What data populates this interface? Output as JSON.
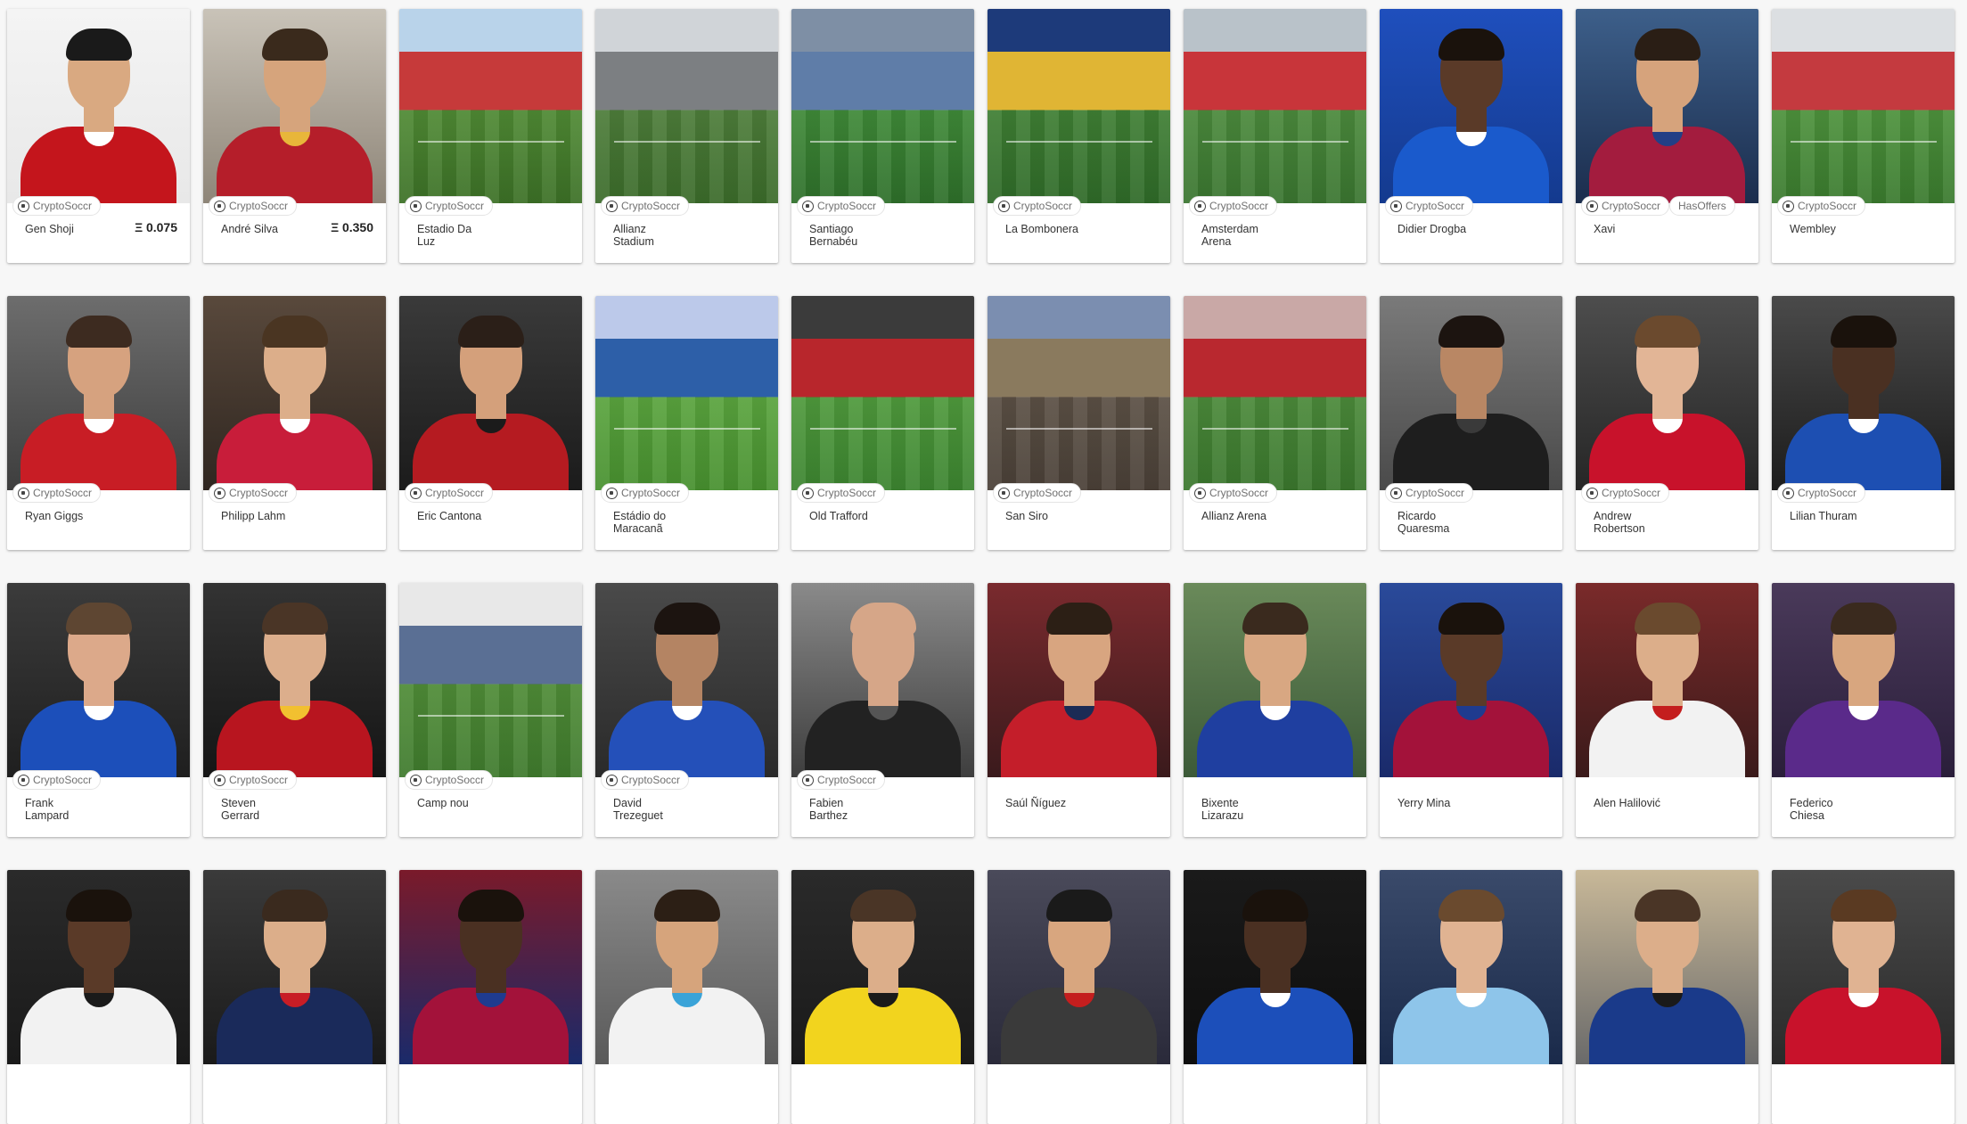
{
  "cards": [
    {
      "type": "player",
      "name": "Gen Shoji",
      "price": "Ξ 0.075",
      "badges": [
        "CryptoSoccr"
      ],
      "palette": {
        "b1": "#f4f4f4",
        "b2": "#e8e8e8",
        "j1": "#c4151c",
        "j2": "#ffffff",
        "skin": "#d9a981",
        "hair": "#1a1a1a"
      }
    },
    {
      "type": "player",
      "name": "André Silva",
      "price": "Ξ 0.350",
      "badges": [
        "CryptoSoccr"
      ],
      "palette": {
        "b1": "#c9c3b8",
        "b2": "#8e8578",
        "j1": "#b51e2a",
        "j2": "#e8b63a",
        "skin": "#d6a47c",
        "hair": "#3a2a1c"
      }
    },
    {
      "type": "stadium",
      "name": "Estadio Da\nLuz",
      "price": "",
      "badges": [
        "CryptoSoccr"
      ],
      "palette": {
        "sky": "#b9d3ea",
        "stand": "#c63a3a",
        "pitch": "#4f8a34",
        "pitch2": "#3c7026"
      }
    },
    {
      "type": "stadium",
      "name": "Allianz\nStadium",
      "price": "",
      "badges": [
        "CryptoSoccr"
      ],
      "palette": {
        "sky": "#d0d4d8",
        "stand": "#7c7f82",
        "pitch": "#4d7d3a",
        "pitch2": "#3b6b2a"
      }
    },
    {
      "type": "stadium",
      "name": "Santiago\nBernabéu",
      "price": "",
      "badges": [
        "CryptoSoccr"
      ],
      "palette": {
        "sky": "#7e8fa5",
        "stand": "#5f7da8",
        "pitch": "#3f8a38",
        "pitch2": "#2e6f2a"
      }
    },
    {
      "type": "stadium",
      "name": "La Bombonera",
      "price": "",
      "badges": [
        "CryptoSoccr"
      ],
      "palette": {
        "sky": "#1d3a7a",
        "stand": "#e0b534",
        "pitch": "#3f7f34",
        "pitch2": "#2f6a28"
      }
    },
    {
      "type": "stadium",
      "name": "Amsterdam\nArena",
      "price": "",
      "badges": [
        "CryptoSoccr"
      ],
      "palette": {
        "sky": "#b9c2c9",
        "stand": "#c8353a",
        "pitch": "#4b8a3c",
        "pitch2": "#3a7530"
      }
    },
    {
      "type": "player",
      "name": "Didier Drogba",
      "price": "",
      "badges": [
        "CryptoSoccr"
      ],
      "palette": {
        "b1": "#1f4fbd",
        "b2": "#143a8e",
        "j1": "#1a5acc",
        "j2": "#ffffff",
        "skin": "#5a3a28",
        "hair": "#1a120c"
      }
    },
    {
      "type": "player",
      "name": "Xavi",
      "price": "",
      "badges": [
        "CryptoSoccr",
        "HasOffers"
      ],
      "palette": {
        "b1": "#3d5f8a",
        "b2": "#1b2d4d",
        "j1": "#a31c3e",
        "j2": "#233f86",
        "skin": "#d6a37c",
        "hair": "#2a1e15"
      }
    },
    {
      "type": "stadium",
      "name": "Wembley",
      "price": "",
      "badges": [
        "CryptoSoccr"
      ],
      "palette": {
        "sky": "#dcdfe2",
        "stand": "#c43a3f",
        "pitch": "#4d923c",
        "pitch2": "#3a7a2e"
      }
    },
    {
      "type": "player",
      "name": "Ryan Giggs",
      "price": "",
      "badges": [
        "CryptoSoccr"
      ],
      "palette": {
        "b1": "#6d6d6d",
        "b2": "#3e3e3e",
        "j1": "#c81d25",
        "j2": "#ffffff",
        "skin": "#d6a27f",
        "hair": "#3d2b20"
      }
    },
    {
      "type": "player",
      "name": "Philipp Lahm",
      "price": "",
      "badges": [
        "CryptoSoccr"
      ],
      "palette": {
        "b1": "#59493c",
        "b2": "#2f2620",
        "j1": "#c81d3a",
        "j2": "#ffffff",
        "skin": "#dcae8a",
        "hair": "#4a3522"
      }
    },
    {
      "type": "player",
      "name": "Eric Cantona",
      "price": "",
      "badges": [
        "CryptoSoccr"
      ],
      "palette": {
        "b1": "#3a3a3a",
        "b2": "#1b1b1b",
        "j1": "#b51b21",
        "j2": "#1b1b1b",
        "skin": "#d4a07b",
        "hair": "#2b1f18"
      }
    },
    {
      "type": "stadium",
      "name": "Estádio do\nMaracanã",
      "price": "",
      "badges": [
        "CryptoSoccr"
      ],
      "palette": {
        "sky": "#bcc9ea",
        "stand": "#2d5fa8",
        "pitch": "#5aa43e",
        "pitch2": "#47902f"
      }
    },
    {
      "type": "stadium",
      "name": "Old Trafford",
      "price": "",
      "badges": [
        "CryptoSoccr"
      ],
      "palette": {
        "sky": "#3b3b3b",
        "stand": "#b8262c",
        "pitch": "#4f9a3c",
        "pitch2": "#3c8430"
      }
    },
    {
      "type": "stadium",
      "name": "San Siro",
      "price": "",
      "badges": [
        "CryptoSoccr"
      ],
      "palette": {
        "sky": "#7b8eb0",
        "stand": "#8a7a5e",
        "pitch": "#5b5045",
        "pitch2": "#4a4037"
      }
    },
    {
      "type": "stadium",
      "name": "Allianz Arena",
      "price": "",
      "badges": [
        "CryptoSoccr"
      ],
      "palette": {
        "sky": "#c9a8a6",
        "stand": "#b9282f",
        "pitch": "#4b8a3a",
        "pitch2": "#3a762d"
      }
    },
    {
      "type": "player",
      "name": "Ricardo\nQuaresma",
      "price": "",
      "badges": [
        "CryptoSoccr"
      ],
      "palette": {
        "b1": "#7a7a7a",
        "b2": "#4a4a4a",
        "j1": "#1e1e1e",
        "j2": "#3a3a3a",
        "skin": "#b98764",
        "hair": "#1c1410"
      }
    },
    {
      "type": "player",
      "name": "Andrew\nRobertson",
      "price": "",
      "badges": [
        "CryptoSoccr"
      ],
      "palette": {
        "b1": "#4d4d4d",
        "b2": "#262626",
        "j1": "#c8122b",
        "j2": "#ffffff",
        "skin": "#e2b596",
        "hair": "#6b4a2e"
      }
    },
    {
      "type": "player",
      "name": "Lilian Thuram",
      "price": "",
      "badges": [
        "CryptoSoccr"
      ],
      "palette": {
        "b1": "#4a4a4a",
        "b2": "#1c1c1c",
        "j1": "#1d4fb2",
        "j2": "#ffffff",
        "skin": "#4a3022",
        "hair": "#1a120c"
      }
    },
    {
      "type": "player",
      "name": "Frank\nLampard",
      "price": "",
      "badges": [
        "CryptoSoccr"
      ],
      "palette": {
        "b1": "#3b3b3b",
        "b2": "#1f1f1f",
        "j1": "#1c4fba",
        "j2": "#ffffff",
        "skin": "#dca98a",
        "hair": "#5e4632"
      }
    },
    {
      "type": "player",
      "name": "Steven\nGerrard",
      "price": "",
      "badges": [
        "CryptoSoccr"
      ],
      "palette": {
        "b1": "#333333",
        "b2": "#151515",
        "j1": "#b8151f",
        "j2": "#f2c030",
        "skin": "#dcae8c",
        "hair": "#4a3526"
      }
    },
    {
      "type": "stadium",
      "name": "Camp nou",
      "price": "",
      "badges": [
        "CryptoSoccr"
      ],
      "palette": {
        "sky": "#e8e8e8",
        "stand": "#5a6f94",
        "pitch": "#4f8c37",
        "pitch2": "#3f7a2d"
      }
    },
    {
      "type": "player",
      "name": "David\nTrezeguet",
      "price": "",
      "badges": [
        "CryptoSoccr"
      ],
      "palette": {
        "b1": "#4a4a4a",
        "b2": "#2a2a2a",
        "j1": "#2450b9",
        "j2": "#ffffff",
        "skin": "#b48463",
        "hair": "#1c1410"
      }
    },
    {
      "type": "player",
      "name": "Fabien\nBarthez",
      "price": "",
      "badges": [
        "CryptoSoccr"
      ],
      "palette": {
        "b1": "#8a8a8a",
        "b2": "#3e3e3e",
        "j1": "#222222",
        "j2": "#555555",
        "skin": "#d6a688",
        "hair": "#d6a688"
      }
    },
    {
      "type": "player",
      "name": "Saúl Ñíguez",
      "price": "",
      "badges": [],
      "palette": {
        "b1": "#7a2a2e",
        "b2": "#3a1a1c",
        "j1": "#c41e2a",
        "j2": "#1b2b55",
        "skin": "#d8a580",
        "hair": "#2c1f15"
      }
    },
    {
      "type": "player",
      "name": "Bixente\nLizarazu",
      "price": "",
      "badges": [],
      "palette": {
        "b1": "#6a8a5a",
        "b2": "#3c5a38",
        "j1": "#1f3fa0",
        "j2": "#ffffff",
        "skin": "#d8a782",
        "hair": "#3a2a1e"
      }
    },
    {
      "type": "player",
      "name": "Yerry Mina",
      "price": "",
      "badges": [],
      "palette": {
        "b1": "#2a4a9a",
        "b2": "#1a2a6a",
        "j1": "#a3123a",
        "j2": "#1f3b8f",
        "skin": "#5a3a28",
        "hair": "#1a120c"
      }
    },
    {
      "type": "player",
      "name": "Alen Halilović",
      "price": "",
      "badges": [],
      "palette": {
        "b1": "#7a2a2a",
        "b2": "#3a1a1a",
        "j1": "#f2f2f2",
        "j2": "#c41e1e",
        "skin": "#dcae8a",
        "hair": "#6a4a2e"
      }
    },
    {
      "type": "player",
      "name": "Federico\nChiesa",
      "price": "",
      "badges": [],
      "palette": {
        "b1": "#4a3a5a",
        "b2": "#2a1e3a",
        "j1": "#5a2a8a",
        "j2": "#ffffff",
        "skin": "#d8a67f",
        "hair": "#3a2a1e"
      }
    },
    {
      "type": "player",
      "name": "",
      "price": "",
      "badges": [],
      "palette": {
        "b1": "#2a2a2a",
        "b2": "#1a1a1a",
        "j1": "#f2f2f2",
        "j2": "#1a1a1a",
        "skin": "#5a3a28",
        "hair": "#1a120c"
      }
    },
    {
      "type": "player",
      "name": "",
      "price": "",
      "badges": [],
      "palette": {
        "b1": "#3a3a3a",
        "b2": "#1a1a1a",
        "j1": "#1a2a5a",
        "j2": "#c81d25",
        "skin": "#dcae8a",
        "hair": "#3a2a1e"
      }
    },
    {
      "type": "player",
      "name": "",
      "price": "",
      "badges": [],
      "palette": {
        "b1": "#7a1a2a",
        "b2": "#1a2a6a",
        "j1": "#a3123a",
        "j2": "#1f3b8f",
        "skin": "#4a3022",
        "hair": "#1a120c"
      }
    },
    {
      "type": "player",
      "name": "",
      "price": "",
      "badges": [],
      "palette": {
        "b1": "#8a8a8a",
        "b2": "#5a5a5a",
        "j1": "#f2f2f2",
        "j2": "#3aa3d8",
        "skin": "#d6a47c",
        "hair": "#2c1f15"
      }
    },
    {
      "type": "player",
      "name": "",
      "price": "",
      "badges": [],
      "palette": {
        "b1": "#2a2a2a",
        "b2": "#1a1a1a",
        "j1": "#f2d41e",
        "j2": "#1a1a1a",
        "skin": "#dcae8a",
        "hair": "#4a3526"
      }
    },
    {
      "type": "player",
      "name": "",
      "price": "",
      "badges": [],
      "palette": {
        "b1": "#4a4a5a",
        "b2": "#2a2a3a",
        "j1": "#3a3a3a",
        "j2": "#c41e1e",
        "skin": "#d8a67f",
        "hair": "#1a1a1a"
      }
    },
    {
      "type": "player",
      "name": "",
      "price": "",
      "badges": [],
      "palette": {
        "b1": "#1a1a1a",
        "b2": "#0e0e0e",
        "j1": "#1c4fba",
        "j2": "#ffffff",
        "skin": "#4a3022",
        "hair": "#1a120c"
      }
    },
    {
      "type": "player",
      "name": "",
      "price": "",
      "badges": [],
      "palette": {
        "b1": "#3a4a6a",
        "b2": "#1a2a4a",
        "j1": "#8ec5ea",
        "j2": "#ffffff",
        "skin": "#e0b392",
        "hair": "#6a4a2e"
      }
    },
    {
      "type": "player",
      "name": "",
      "price": "",
      "badges": [],
      "palette": {
        "b1": "#c8b898",
        "b2": "#6a6a6a",
        "j1": "#1a3a8a",
        "j2": "#1a1a1a",
        "skin": "#dcae8a",
        "hair": "#4a3526"
      }
    },
    {
      "type": "player",
      "name": "",
      "price": "",
      "badges": [],
      "palette": {
        "b1": "#4a4a4a",
        "b2": "#2a2a2a",
        "j1": "#c8122b",
        "j2": "#ffffff",
        "skin": "#e0b392",
        "hair": "#5a3a22"
      }
    }
  ]
}
